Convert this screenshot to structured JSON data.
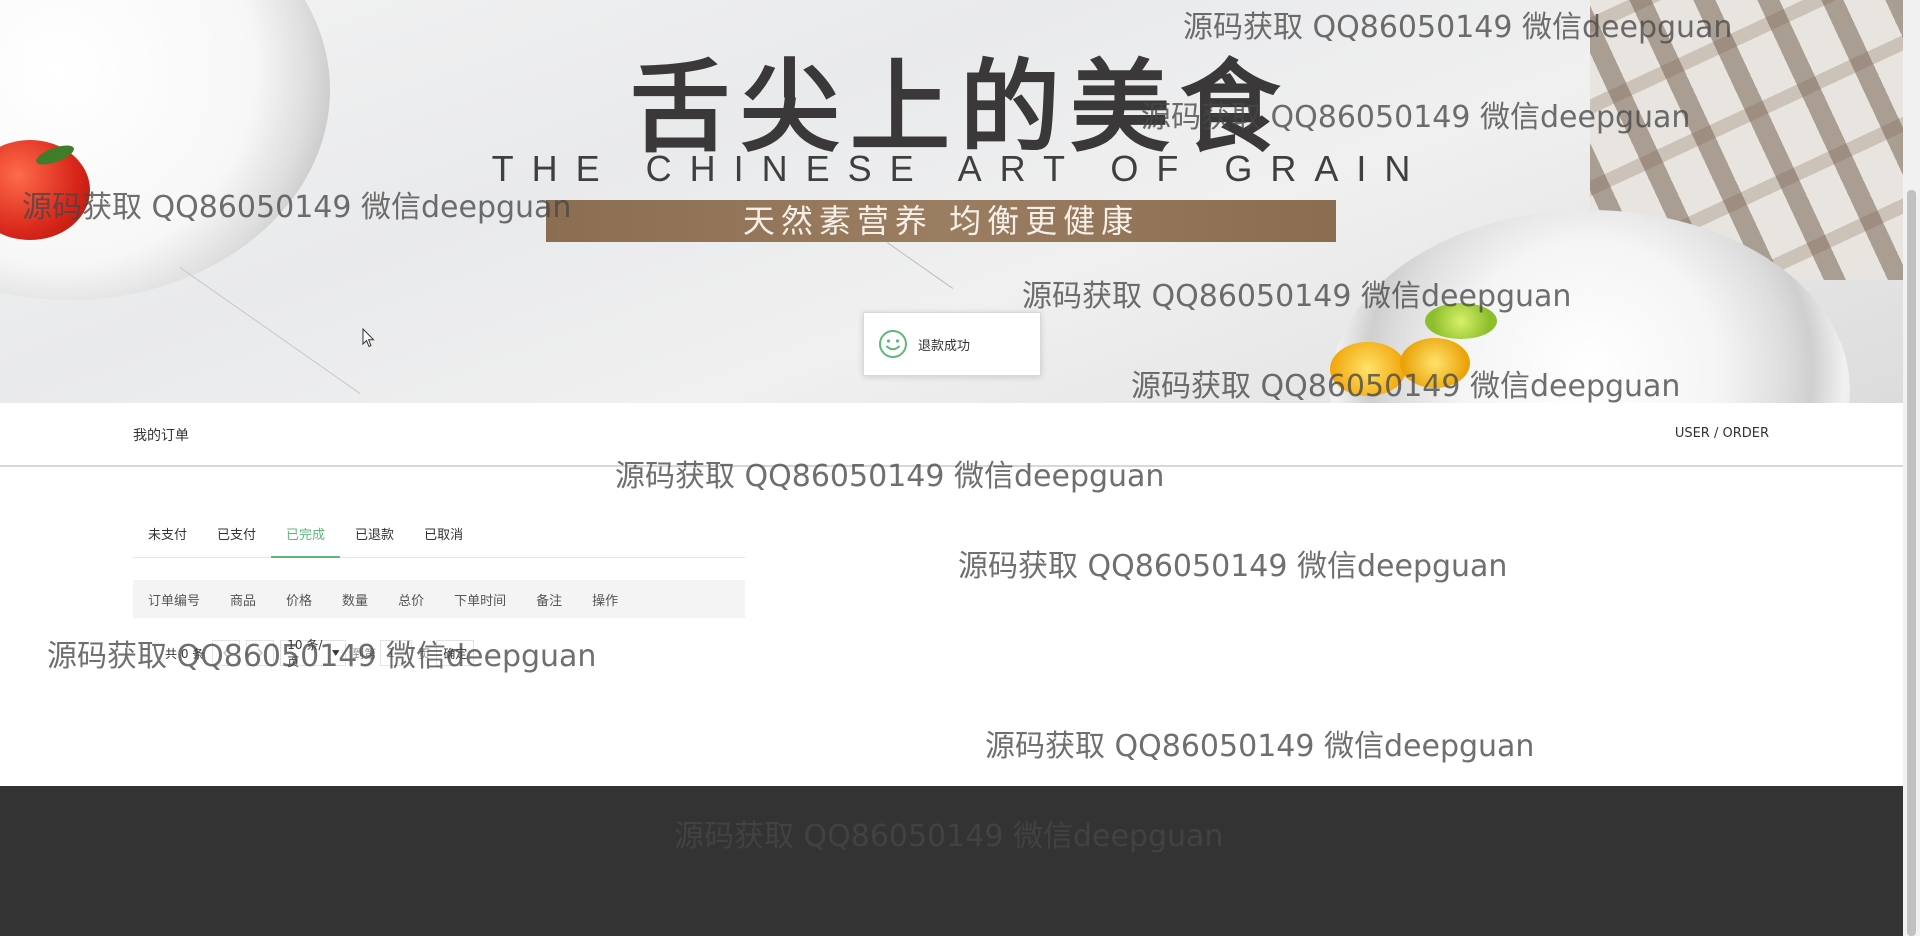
{
  "banner": {
    "title": "舌尖上的美食",
    "subtitle": "THE CHINESE ART OF GRAIN",
    "strip": "天然素营养 均衡更健康"
  },
  "toast": {
    "text": "退款成功",
    "icon": "smile-icon"
  },
  "section": {
    "title": "我的订单",
    "path": "USER / ORDER"
  },
  "tabs": [
    {
      "label": "未支付"
    },
    {
      "label": "已支付"
    },
    {
      "label": "已完成",
      "active": true
    },
    {
      "label": "已退款"
    },
    {
      "label": "已取消"
    }
  ],
  "table": {
    "headers": [
      "订单编号",
      "商品",
      "价格",
      "数量",
      "总价",
      "下单时间",
      "备注",
      "操作"
    ]
  },
  "pagination": {
    "count": "共 0 条",
    "page_size": "10 条/页",
    "goto": "到第",
    "page": "1",
    "page_unit": "页",
    "confirm": "确定"
  },
  "watermark": "源码获取 QQ86050149 微信deepguan",
  "colors": {
    "accent": "#5fb878",
    "footer": "#333333"
  }
}
